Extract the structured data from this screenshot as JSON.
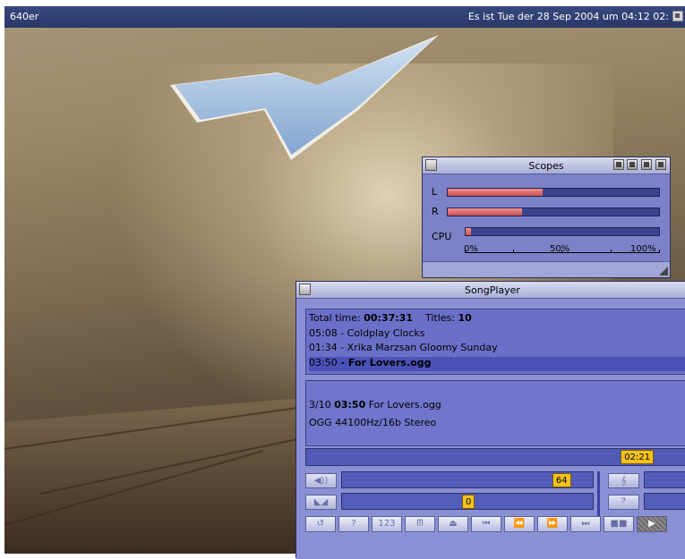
{
  "screen": {
    "title": "640er",
    "clock": "Es ist Tue der 28 Sep 2004 um 04:12 02:"
  },
  "scopes": {
    "title": "Scopes",
    "rows": [
      {
        "label": "L",
        "level": 0.45
      },
      {
        "label": "R",
        "level": 0.35
      },
      {
        "label": "CPU",
        "level": 0.03
      }
    ],
    "scale": [
      "0%",
      "50%",
      "100%"
    ]
  },
  "songplayer": {
    "title": "SongPlayer",
    "summary": {
      "total_label": "Total time:",
      "total_value": "00:37:31",
      "titles_label": "Titles:",
      "titles_value": "10"
    },
    "playlist": [
      {
        "time": "05:08",
        "name": " - Coldplay Clocks",
        "current": false
      },
      {
        "time": "01:34",
        "name": " - Xrika Marzsan Gloomy Sunday",
        "current": false
      },
      {
        "time": "03:50",
        "name": " - For Lovers.ogg",
        "current": true
      }
    ],
    "info": {
      "track_index": "3/10",
      "track_time": "03:50",
      "track_name": "For Lovers.ogg",
      "format": "OGG  44100Hz/16b Stereo"
    },
    "position": {
      "value": "02:21",
      "fraction": 0.86
    },
    "volume": {
      "value": "64",
      "fraction": 0.87
    },
    "balance": {
      "value": "0",
      "fraction": 0.5
    },
    "left_icons": [
      "volume-icon",
      "balance-icon"
    ],
    "right_icons": [
      "treble-clef-icon",
      "bass-clef-icon"
    ],
    "right_glyphs": [
      "𝄞",
      "𝄢"
    ],
    "transport": [
      {
        "name": "repeat-button",
        "glyph": "↺"
      },
      {
        "name": "help-button",
        "glyph": "?"
      },
      {
        "name": "counter-button",
        "glyph": "123"
      },
      {
        "name": "loop-button",
        "glyph": "ᗰ"
      },
      {
        "name": "eject-button",
        "glyph": "⏏"
      },
      {
        "name": "first-track-button",
        "glyph": "⏮"
      },
      {
        "name": "rewind-button",
        "glyph": "⏪"
      },
      {
        "name": "forward-button",
        "glyph": "⏩"
      },
      {
        "name": "last-track-button",
        "glyph": "⏭"
      },
      {
        "name": "stop-button",
        "glyph": "■■"
      },
      {
        "name": "play-button",
        "glyph": "▶"
      }
    ]
  }
}
